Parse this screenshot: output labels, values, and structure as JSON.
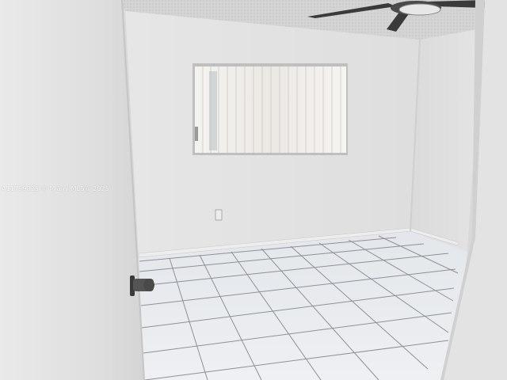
{
  "photo": {
    "watermark": "A11799825 © Miami MLS® 2025",
    "colors": {
      "wall_back": "#e4e4e4",
      "wall_right": "#dadada",
      "ceiling": "#d2d2d2",
      "floor_tile": "#e9ecef",
      "grout": "#8a8e94",
      "door": "#e7e7e7",
      "blinds": "#f1efec",
      "fan": "#3c3c3c"
    }
  }
}
